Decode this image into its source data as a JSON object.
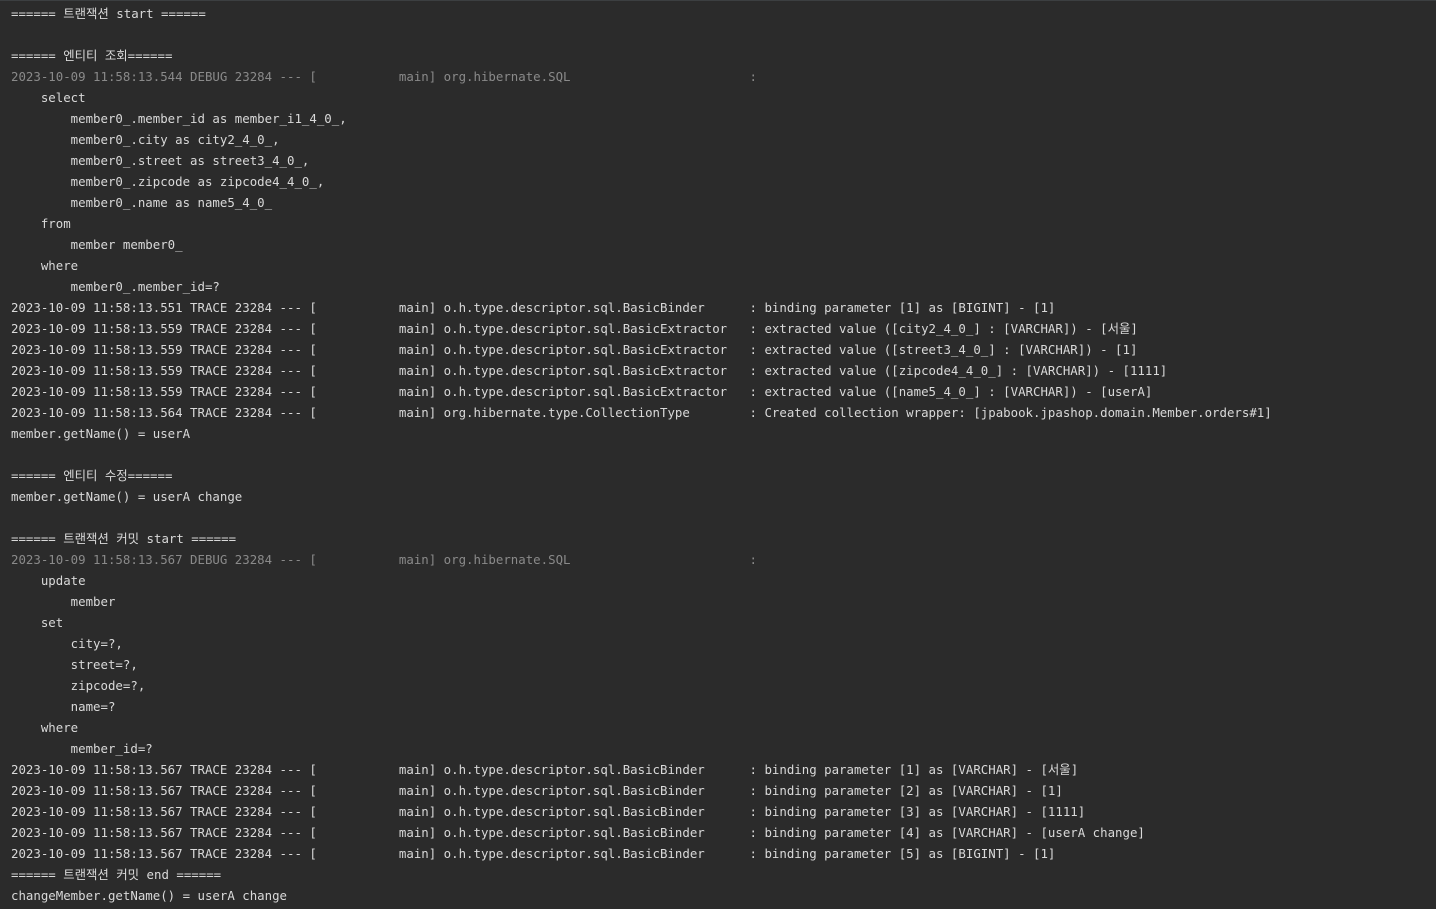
{
  "console": {
    "lines": [
      {
        "text": "====== 트랜잭션 start ======",
        "style": "normal"
      },
      {
        "text": "",
        "style": "blank"
      },
      {
        "text": "====== 엔티티 조회======",
        "style": "normal"
      },
      {
        "text": "2023-10-09 11:58:13.544 DEBUG 23284 --- [           main] org.hibernate.SQL                        : ",
        "style": "muted"
      },
      {
        "text": "    select",
        "style": "normal"
      },
      {
        "text": "        member0_.member_id as member_i1_4_0_,",
        "style": "normal"
      },
      {
        "text": "        member0_.city as city2_4_0_,",
        "style": "normal"
      },
      {
        "text": "        member0_.street as street3_4_0_,",
        "style": "normal"
      },
      {
        "text": "        member0_.zipcode as zipcode4_4_0_,",
        "style": "normal"
      },
      {
        "text": "        member0_.name as name5_4_0_",
        "style": "normal"
      },
      {
        "text": "    from",
        "style": "normal"
      },
      {
        "text": "        member member0_",
        "style": "normal"
      },
      {
        "text": "    where",
        "style": "normal"
      },
      {
        "text": "        member0_.member_id=?",
        "style": "normal"
      },
      {
        "text": "2023-10-09 11:58:13.551 TRACE 23284 --- [           main] o.h.type.descriptor.sql.BasicBinder      : binding parameter [1] as [BIGINT] - [1]",
        "style": "normal"
      },
      {
        "text": "2023-10-09 11:58:13.559 TRACE 23284 --- [           main] o.h.type.descriptor.sql.BasicExtractor   : extracted value ([city2_4_0_] : [VARCHAR]) - [서울]",
        "style": "normal"
      },
      {
        "text": "2023-10-09 11:58:13.559 TRACE 23284 --- [           main] o.h.type.descriptor.sql.BasicExtractor   : extracted value ([street3_4_0_] : [VARCHAR]) - [1]",
        "style": "normal"
      },
      {
        "text": "2023-10-09 11:58:13.559 TRACE 23284 --- [           main] o.h.type.descriptor.sql.BasicExtractor   : extracted value ([zipcode4_4_0_] : [VARCHAR]) - [1111]",
        "style": "normal"
      },
      {
        "text": "2023-10-09 11:58:13.559 TRACE 23284 --- [           main] o.h.type.descriptor.sql.BasicExtractor   : extracted value ([name5_4_0_] : [VARCHAR]) - [userA]",
        "style": "normal"
      },
      {
        "text": "2023-10-09 11:58:13.564 TRACE 23284 --- [           main] org.hibernate.type.CollectionType        : Created collection wrapper: [jpabook.jpashop.domain.Member.orders#1]",
        "style": "normal"
      },
      {
        "text": "member.getName() = userA",
        "style": "normal"
      },
      {
        "text": "",
        "style": "blank"
      },
      {
        "text": "====== 엔티티 수정======",
        "style": "normal"
      },
      {
        "text": "member.getName() = userA change",
        "style": "normal"
      },
      {
        "text": "",
        "style": "blank"
      },
      {
        "text": "====== 트랜잭션 커밋 start ======",
        "style": "normal"
      },
      {
        "text": "2023-10-09 11:58:13.567 DEBUG 23284 --- [           main] org.hibernate.SQL                        : ",
        "style": "muted"
      },
      {
        "text": "    update",
        "style": "normal"
      },
      {
        "text": "        member",
        "style": "normal"
      },
      {
        "text": "    set",
        "style": "normal"
      },
      {
        "text": "        city=?,",
        "style": "normal"
      },
      {
        "text": "        street=?,",
        "style": "normal"
      },
      {
        "text": "        zipcode=?,",
        "style": "normal"
      },
      {
        "text": "        name=?",
        "style": "normal"
      },
      {
        "text": "    where",
        "style": "normal"
      },
      {
        "text": "        member_id=?",
        "style": "normal"
      },
      {
        "text": "2023-10-09 11:58:13.567 TRACE 23284 --- [           main] o.h.type.descriptor.sql.BasicBinder      : binding parameter [1] as [VARCHAR] - [서울]",
        "style": "normal"
      },
      {
        "text": "2023-10-09 11:58:13.567 TRACE 23284 --- [           main] o.h.type.descriptor.sql.BasicBinder      : binding parameter [2] as [VARCHAR] - [1]",
        "style": "normal"
      },
      {
        "text": "2023-10-09 11:58:13.567 TRACE 23284 --- [           main] o.h.type.descriptor.sql.BasicBinder      : binding parameter [3] as [VARCHAR] - [1111]",
        "style": "normal"
      },
      {
        "text": "2023-10-09 11:58:13.567 TRACE 23284 --- [           main] o.h.type.descriptor.sql.BasicBinder      : binding parameter [4] as [VARCHAR] - [userA change]",
        "style": "normal"
      },
      {
        "text": "2023-10-09 11:58:13.567 TRACE 23284 --- [           main] o.h.type.descriptor.sql.BasicBinder      : binding parameter [5] as [BIGINT] - [1]",
        "style": "normal"
      },
      {
        "text": "====== 트랜잭션 커밋 end ======",
        "style": "normal"
      },
      {
        "text": "changeMember.getName() = userA change",
        "style": "normal"
      }
    ]
  },
  "colors": {
    "background": "#2b2b2b",
    "text": "#d9d9d9",
    "muted": "#8a8a8a"
  }
}
